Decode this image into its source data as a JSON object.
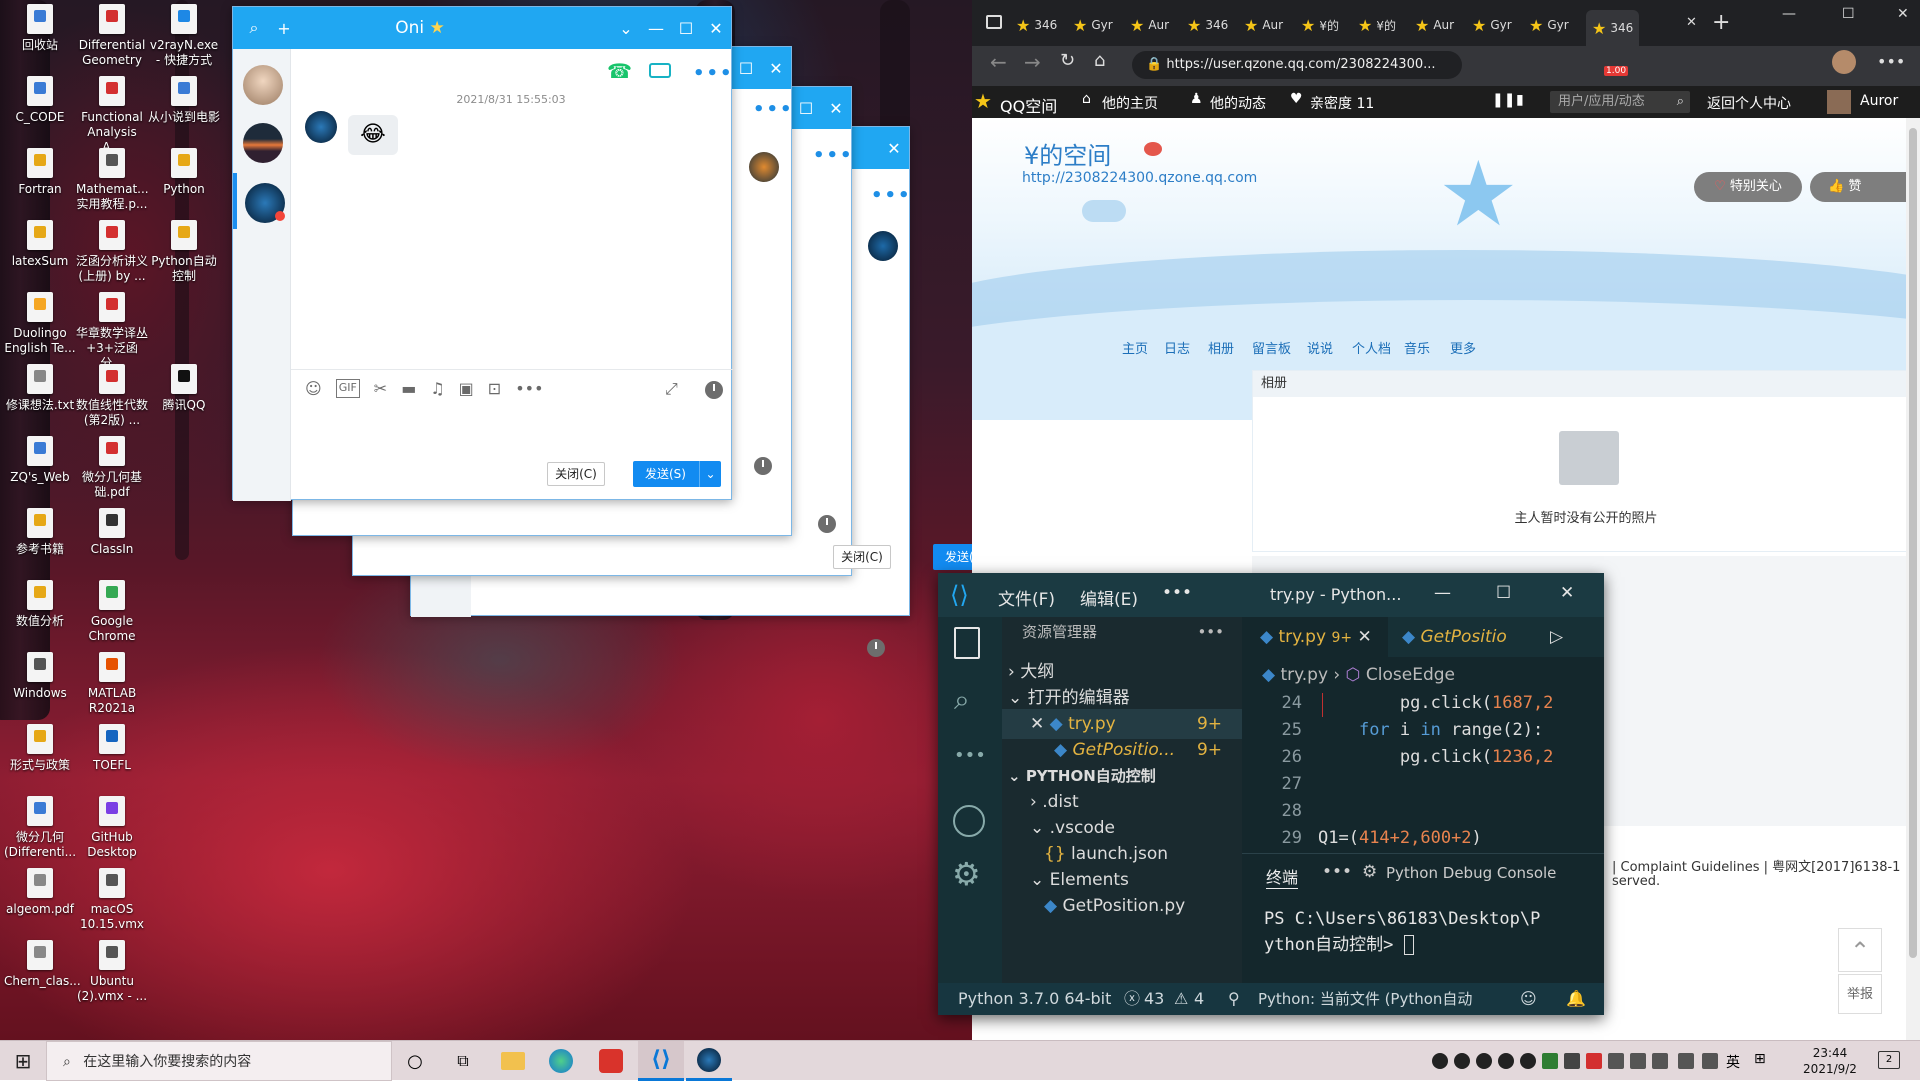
{
  "desktop_icons": [
    {
      "label": "回收站",
      "color": "#3a7bd5"
    },
    {
      "label": "Differential Geometry ...",
      "color": "#d32f2f"
    },
    {
      "label": "v2rayN.exe - 快捷方式",
      "color": "#1e88e5"
    },
    {
      "label": "C_CODE",
      "color": "#3a7bd5"
    },
    {
      "label": "Functional Analysis A...",
      "color": "#d32f2f"
    },
    {
      "label": "从小说到电影",
      "color": "#3a7bd5"
    },
    {
      "label": "Fortran",
      "color": "#e6a817"
    },
    {
      "label": "Mathemat... 实用教程.p...",
      "color": "#555"
    },
    {
      "label": "Python",
      "color": "#e6a817"
    },
    {
      "label": "latexSum",
      "color": "#e6a817"
    },
    {
      "label": "泛函分析讲义(上册) by ...",
      "color": "#d32f2f"
    },
    {
      "label": "Python自动控制",
      "color": "#e6a817"
    },
    {
      "label": "Duolingo English Te...",
      "color": "#f5a623"
    },
    {
      "label": "华章数学译丛+3+泛函分...",
      "color": "#d32f2f"
    },
    {
      "label": "修课想法.txt",
      "color": "#888"
    },
    {
      "label": "数值线性代数(第2版) ...",
      "color": "#d32f2f"
    },
    {
      "label": "腾讯QQ",
      "color": "#111"
    },
    {
      "label": "ZQ's_Web",
      "color": "#3a7bd5"
    },
    {
      "label": "微分几何基础.pdf",
      "color": "#d32f2f"
    },
    {
      "label": "参考书籍",
      "color": "#e6a817"
    },
    {
      "label": "ClassIn",
      "color": "#333"
    },
    {
      "label": "数值分析",
      "color": "#e6a817"
    },
    {
      "label": "Google Chrome",
      "color": "#34a853"
    },
    {
      "label": "Windows",
      "color": "#555"
    },
    {
      "label": "MATLAB R2021a",
      "color": "#e65100"
    },
    {
      "label": "形式与政策",
      "color": "#e6a817"
    },
    {
      "label": "TOEFL",
      "color": "#1565c0"
    },
    {
      "label": "微分几何(Differenti...",
      "color": "#3a7bd5"
    },
    {
      "label": "GitHub Desktop",
      "color": "#7b3fe4"
    },
    {
      "label": "algeom.pdf",
      "color": "#888"
    },
    {
      "label": "macOS 10.15.vmx ...",
      "color": "#555"
    },
    {
      "label": "Chern_clas...",
      "color": "#888"
    },
    {
      "label": "Ubuntu (2).vmx - ...",
      "color": "#555"
    }
  ],
  "qq": {
    "title": "Oni",
    "timestamp": "2021/8/31 15:55:03",
    "close_label": "关闭(C)",
    "send_label": "发送(S)",
    "emoji": "😂"
  },
  "browser": {
    "tabs": [
      "346",
      "Gyr",
      "Aur",
      "346",
      "Aur",
      "¥的",
      "¥的",
      "Aur",
      "Gyr",
      "Gyr",
      "346"
    ],
    "url": "https://user.qzone.qq.com/2308224300...",
    "qzone_label": "QQ空间",
    "home_label": "他的主页",
    "feed_label": "他的动态",
    "intimacy_label": "亲密度 11",
    "search_placeholder": "用户/应用/动态",
    "back_center": "返回个人中心",
    "user_short": "Auror",
    "space_title": "¥的空间",
    "space_url": "http://2308224300.qzone.qq.com",
    "special_care": "特别关心",
    "like": "赞",
    "nav": [
      "主页",
      "日志",
      "相册",
      "留言板",
      "说说",
      "个人档",
      "音乐",
      "更多"
    ],
    "album_title": "相册",
    "no_photos": "主人暂时没有公开的照片",
    "footer_line1": "| Complaint Guidelines | 粤网文[2017]6138-1",
    "footer_line2": "served.",
    "report": "举报",
    "extension_badge": "1.00"
  },
  "vscode": {
    "menu_file": "文件(F)",
    "menu_edit": "编辑(E)",
    "title": "try.py - Python...",
    "explorer_title": "资源管理器",
    "outline": "大纲",
    "open_editors": "打开的编辑器",
    "open_file1": "try.py",
    "open_file2": "GetPositio...",
    "badge": "9+",
    "folder": "PYTHON自动控制",
    "tree": [
      ".dist",
      ".vscode",
      "launch.json",
      "Elements",
      "GetPosition.py"
    ],
    "tab1": "try.py",
    "tab2": "GetPositio",
    "breadcrumb_file": "try.py",
    "breadcrumb_symbol": "CloseEdge",
    "lines": [
      {
        "n": "24",
        "pre": "        pg.click(",
        "num": "1687,2",
        "post": ""
      },
      {
        "n": "25",
        "pre": "    ",
        "kw": "for",
        "mid": " i ",
        "kw2": "in",
        "post": " range(2):"
      },
      {
        "n": "26",
        "pre": "        pg.click(",
        "num": "1236,2",
        "post": ""
      },
      {
        "n": "27",
        "pre": "",
        "post": ""
      },
      {
        "n": "28",
        "pre": "",
        "post": ""
      },
      {
        "n": "29",
        "pre": "Q1=(",
        "num": "414+2,600+2",
        "post": ")"
      }
    ],
    "panel_terminal": "终端",
    "panel_debug": "Python Debug Console",
    "terminal_line1": "PS C:\\Users\\86183\\Desktop\\P",
    "terminal_line2": "ython自动控制> ",
    "status_python": "Python 3.7.0 64-bit",
    "status_errors": "43",
    "status_warnings": "4",
    "status_run": "Python: 当前文件 (Python自动"
  },
  "taskbar": {
    "search_placeholder": "在这里输入你要搜索的内容",
    "ime": "英",
    "time": "23:44",
    "date": "2021/9/2",
    "notif_count": "2"
  }
}
